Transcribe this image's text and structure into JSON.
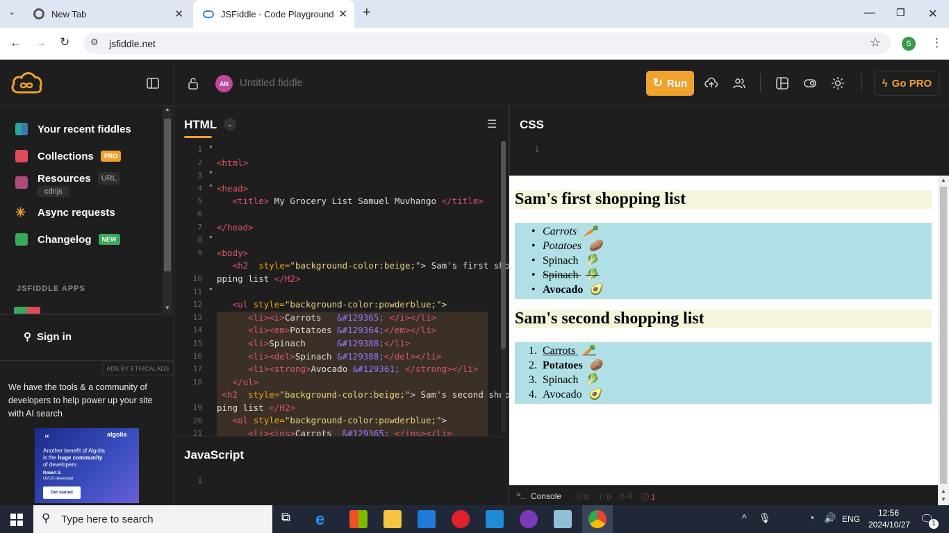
{
  "browser": {
    "tabs": [
      {
        "title": "New Tab"
      },
      {
        "title": "JSFiddle - Code Playground"
      }
    ],
    "url": "jsfiddle.net",
    "profile_initial": "S"
  },
  "header": {
    "avatar_initials": "AN",
    "fiddle_name": "Untitled fiddle",
    "run_label": "Run",
    "gopro_label": "Go PRO"
  },
  "sidebar": {
    "items": [
      {
        "label": "Your recent fiddles"
      },
      {
        "label": "Collections",
        "badge": "PRO"
      },
      {
        "label": "Resources",
        "badge": "URL",
        "sub": "cdnjs"
      },
      {
        "label": "Async requests"
      },
      {
        "label": "Changelog",
        "badge": "NEW"
      }
    ],
    "apps_heading": "JSFIDDLE APPS",
    "signin_label": "Sign in",
    "ads_label": "ADS BY ETHICALADS",
    "ad_text": "We have the tools & a community of developers to help power up your site with AI search",
    "ad_image": {
      "brand": "algolia",
      "quote_line1": "Another benefit of Algolia",
      "quote_line2a": "is the ",
      "quote_line2b": "huge community",
      "quote_line3": "of developers.",
      "author": "Robert S.",
      "role": "UI/UX developer",
      "cta": "Get started"
    }
  },
  "panels": {
    "html_title": "HTML",
    "css_title": "CSS",
    "js_title": "JavaScript",
    "console_label": "Console",
    "console_counts": [
      "0",
      "0",
      "0",
      "1"
    ]
  },
  "html_code": {
    "line_numbers": [
      "1",
      "2",
      "3",
      "4",
      "5",
      "6",
      "7",
      "8",
      "9",
      "",
      "10",
      "11",
      "12",
      "13",
      "14",
      "15",
      "16",
      "17",
      "18",
      "",
      "19",
      "20",
      "21"
    ]
  },
  "result": {
    "heading1": "Sam's first shopping list",
    "list1": [
      {
        "text": "Carrots",
        "style": "italic",
        "emoji": "🥕"
      },
      {
        "text": "Potatoes",
        "style": "italic",
        "emoji": "🥔"
      },
      {
        "text": "Spinach",
        "style": "normal",
        "emoji": "🥬"
      },
      {
        "text": "Spinach",
        "style": "strike",
        "emoji": "🥬"
      },
      {
        "text": "Avocado",
        "style": "bold",
        "emoji": "🥑"
      }
    ],
    "heading2": "Sam's second shopping list",
    "list2": [
      {
        "num": "1.",
        "text": "Carrots",
        "style": "underline",
        "emoji": "🥕"
      },
      {
        "num": "2.",
        "text": "Potatoes",
        "style": "bold",
        "emoji": "🥔"
      },
      {
        "num": "3.",
        "text": "Spinach",
        "style": "normal",
        "emoji": "🥬"
      },
      {
        "num": "4.",
        "text": "Avocado",
        "style": "normal",
        "emoji": "🥑"
      }
    ]
  },
  "taskbar": {
    "search_placeholder": "Type here to search",
    "lang": "ENG",
    "time": "12:56",
    "date": "2024/10/27",
    "notif_count": "1"
  }
}
